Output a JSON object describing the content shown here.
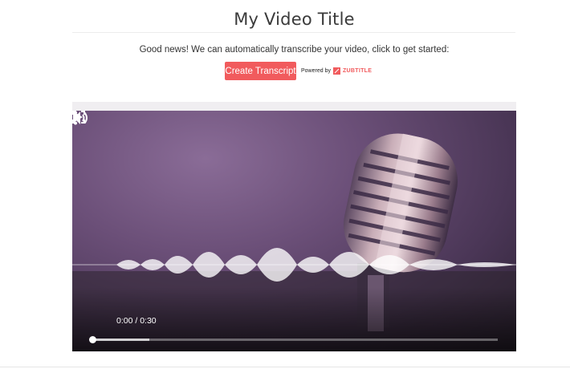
{
  "page": {
    "title": "My Video Title",
    "notice": "Good news! We can automatically transcribe your video, click to get started:",
    "create_transcript_label": "Create Transcript",
    "powered_by": "Powered by",
    "brand_name": "ZUBTITLE",
    "brand_color": "#f15b5d"
  },
  "player": {
    "time_display": "0:00 / 0:30",
    "progress_fraction": 0.0,
    "buffered_fraction": 0.14,
    "icons": {
      "play": "play-icon",
      "volume": "volume-icon",
      "fullscreen": "fullscreen-icon",
      "more": "more-vert-icon"
    }
  }
}
